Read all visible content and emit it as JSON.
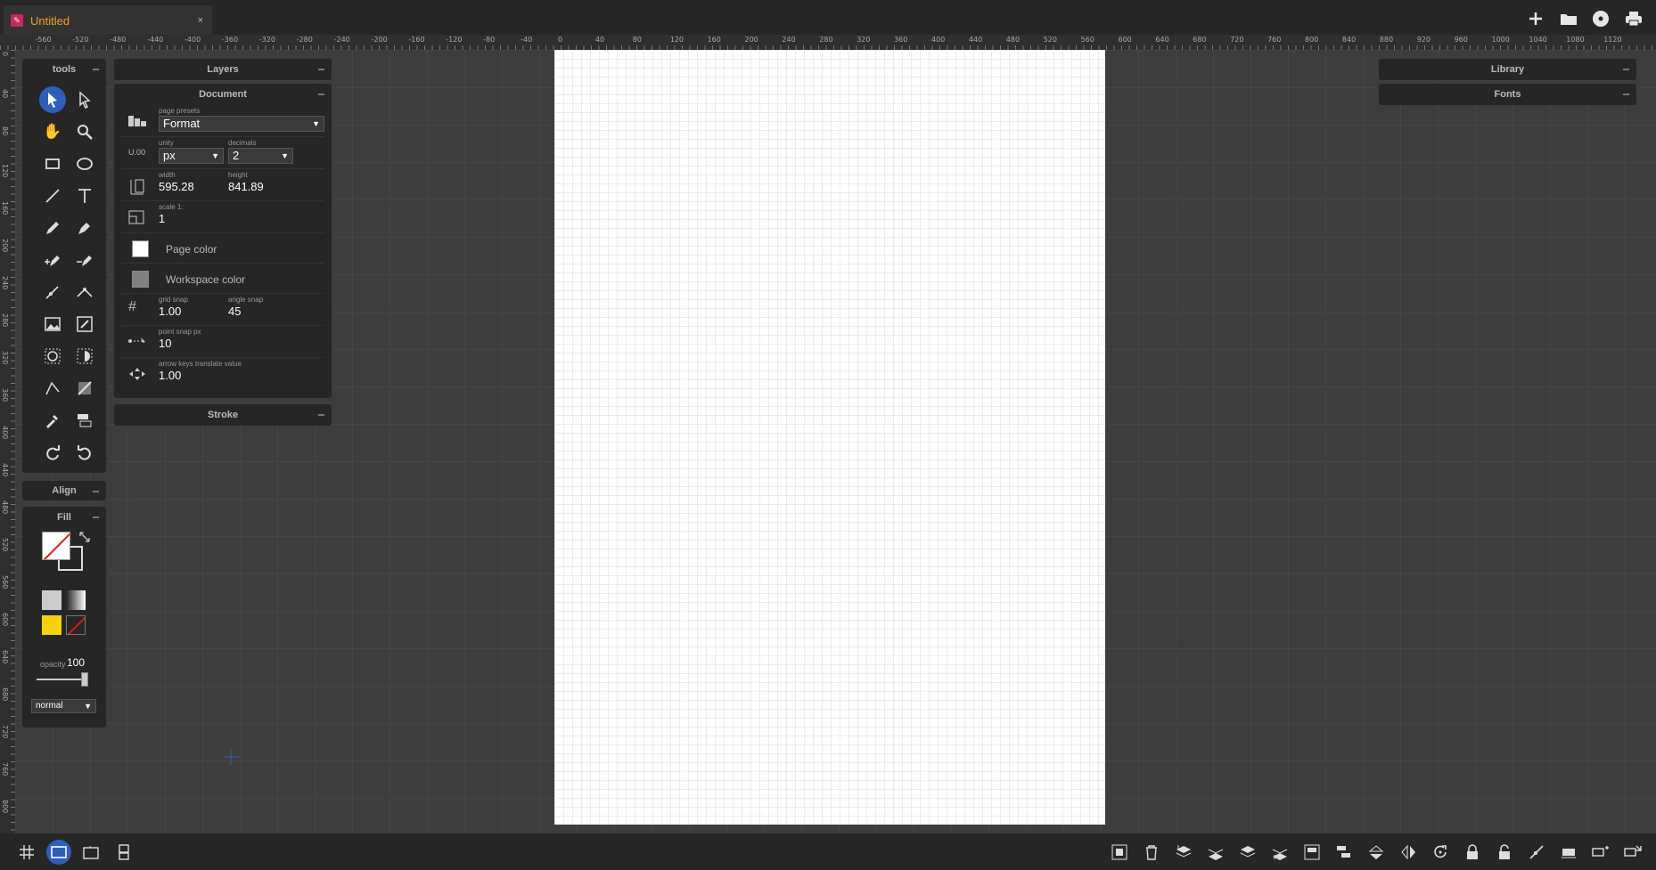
{
  "tab": {
    "title": "Untitled",
    "close": "×"
  },
  "top_icons": [
    "plus-icon",
    "folder-icon",
    "disc-icon",
    "print-icon"
  ],
  "ruler": {
    "h_ticks": [
      "-560",
      "-520",
      "-480",
      "-440",
      "-400",
      "-360",
      "-320",
      "-280",
      "-240",
      "-200",
      "-160",
      "-120",
      "-80",
      "-40",
      "0",
      "40",
      "80",
      "120",
      "160",
      "200",
      "240",
      "280",
      "320",
      "360",
      "400",
      "440",
      "480",
      "520",
      "560",
      "600",
      "640",
      "680",
      "720",
      "760",
      "800",
      "840",
      "880",
      "920",
      "960",
      "1000",
      "1040",
      "1080",
      "1120"
    ],
    "v_ticks": [
      "0",
      "40",
      "80",
      "120",
      "160",
      "200",
      "240",
      "280",
      "320",
      "360",
      "400",
      "440",
      "480",
      "520",
      "560",
      "600",
      "640",
      "680",
      "720",
      "760",
      "800"
    ]
  },
  "panels": {
    "tools": "tools",
    "align": "Align",
    "fill": "Fill",
    "layers": "Layers",
    "document": "Document",
    "stroke": "Stroke",
    "library": "Library",
    "fonts": "Fonts"
  },
  "document": {
    "page_presets_label": "page presets",
    "page_presets_value": "Format",
    "unity_icon_text": "U.00",
    "unity_label": "unity",
    "unity_value": "px",
    "decimals_label": "decimals",
    "decimals_value": "2",
    "width_label": "width",
    "width_value": "595.28",
    "height_label": "height",
    "height_value": "841.89",
    "scale_label": "scale 1:",
    "scale_value": "1",
    "page_color_label": "Page color",
    "page_color": "#ffffff",
    "workspace_color_label": "Workspace color",
    "workspace_color": "#808080",
    "grid_snap_label": "grid snap",
    "grid_snap_value": "1.00",
    "angle_snap_label": "angle snap",
    "angle_snap_value": "45",
    "point_snap_label": "point snap px",
    "point_snap_value": "10",
    "arrow_keys_label": "arrow keys translate value",
    "arrow_keys_value": "1.00"
  },
  "fill": {
    "opacity_label": "opacity",
    "opacity_value": "100",
    "blend_mode": "normal",
    "swatch_colors": [
      "#cccccc",
      "#888888",
      "#f5d20a",
      "#d81b1b"
    ]
  },
  "colors": {
    "accent": "#2e5fb8",
    "tab_title": "#f0a020",
    "app_icon": "#c62b57"
  }
}
